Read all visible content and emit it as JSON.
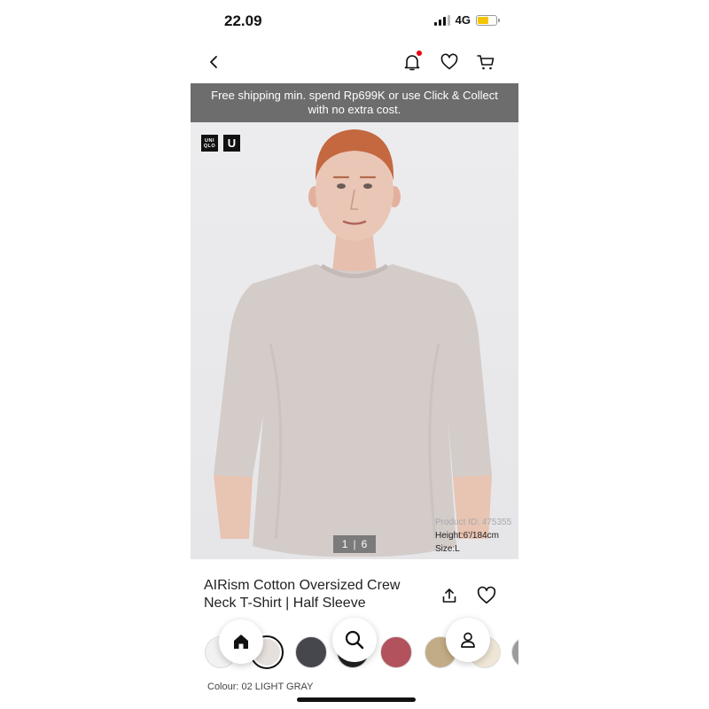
{
  "status_bar": {
    "time": "22.09",
    "network": "4G",
    "battery_level": 0.6
  },
  "nav": {
    "back_icon": "chevron-left-icon",
    "notification_icon": "bell-icon",
    "favorites_icon": "heart-icon",
    "cart_icon": "cart-icon"
  },
  "banner": {
    "text": "Free shipping min. spend Rp699K or use Click & Collect with no extra cost."
  },
  "hero": {
    "brand_logo": [
      "UNI",
      "QLO"
    ],
    "sub_brand_logo": "U",
    "image_index": "1",
    "image_total": "6",
    "counter_separator": "|",
    "product_id_text": "Product ID: 475355",
    "height_text": "Height:6'/184cm",
    "size_text": "Size:L"
  },
  "product": {
    "title": "AIRism Cotton Oversized Crew Neck T-Shirt | Half Sleeve",
    "share_icon": "share-icon",
    "wishlist_icon": "heart-icon"
  },
  "swatches": [
    {
      "name": "white",
      "color": "#f2f2f2"
    },
    {
      "name": "light-gray",
      "color": "#e6e0dc",
      "selected": true
    },
    {
      "name": "dark-gray",
      "color": "#45474c"
    },
    {
      "name": "black",
      "color": "#222222"
    },
    {
      "name": "red",
      "color": "#b2525c"
    },
    {
      "name": "beige",
      "color": "#c2ac85"
    },
    {
      "name": "off-white",
      "color": "#efe6d5"
    },
    {
      "name": "gray",
      "color": "#9c9c9c"
    }
  ],
  "tab_bar": {
    "home_icon": "home-icon",
    "search_icon": "search-icon",
    "account_icon": "user-icon"
  },
  "colour_label": "Colour: 02 LIGHT GRAY"
}
